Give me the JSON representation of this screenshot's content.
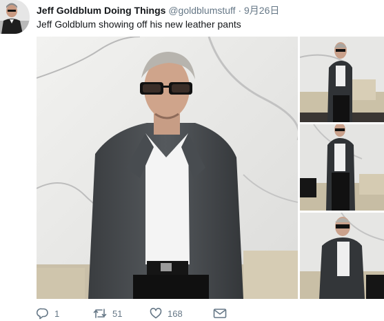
{
  "tweet": {
    "author_name": "Jeff Goldblum Doing Things",
    "handle": "@goldblumstuff",
    "separator": "·",
    "date": "9月26日",
    "text": "Jeff Goldblum showing off his new leather pants"
  },
  "actions": {
    "reply_count": "1",
    "retweet_count": "51",
    "like_count": "168"
  },
  "icons": {
    "reply": "reply-icon",
    "retweet": "retweet-icon",
    "like": "heart-icon",
    "message": "envelope-icon"
  },
  "colors": {
    "text": "#14171a",
    "secondary": "#657786"
  }
}
